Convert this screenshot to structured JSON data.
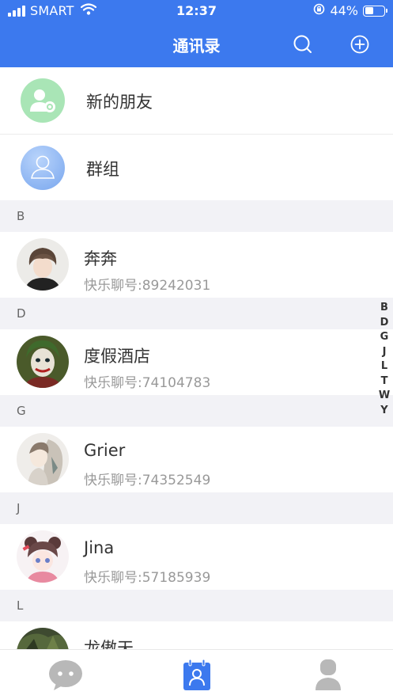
{
  "status_bar": {
    "carrier": "SMART",
    "time": "12:37",
    "battery_percent_text": "44%",
    "battery_level": 0.44
  },
  "nav": {
    "title": "通讯录",
    "search_icon": "search-icon",
    "add_icon": "plus-circle-icon"
  },
  "special_rows": [
    {
      "label": "新的朋友",
      "icon": "new-friend-icon",
      "color": "#a9e5b6"
    },
    {
      "label": "群组",
      "icon": "group-icon",
      "color": "#8fb8f4"
    }
  ],
  "sections": [
    {
      "letter": "B",
      "contacts": [
        {
          "name": "奔奔",
          "id": "快乐聊号:89242031"
        }
      ]
    },
    {
      "letter": "D",
      "contacts": [
        {
          "name": "度假酒店",
          "id": "快乐聊号:74104783"
        }
      ]
    },
    {
      "letter": "G",
      "contacts": [
        {
          "name": "Grier",
          "id": "快乐聊号:74352549"
        }
      ]
    },
    {
      "letter": "J",
      "contacts": [
        {
          "name": "Jina",
          "id": "快乐聊号:57185939"
        }
      ]
    },
    {
      "letter": "L",
      "contacts": [
        {
          "name": "龙傲天",
          "id": ""
        }
      ]
    }
  ],
  "index_letters": [
    "B",
    "D",
    "G",
    "J",
    "L",
    "T",
    "W",
    "Y"
  ],
  "tabs": [
    {
      "icon": "chat-icon",
      "active": false
    },
    {
      "icon": "contacts-icon",
      "active": true
    },
    {
      "icon": "profile-icon",
      "active": false
    }
  ],
  "colors": {
    "brand": "#3c79ee",
    "inactive_tab": "#b8b8b8"
  }
}
